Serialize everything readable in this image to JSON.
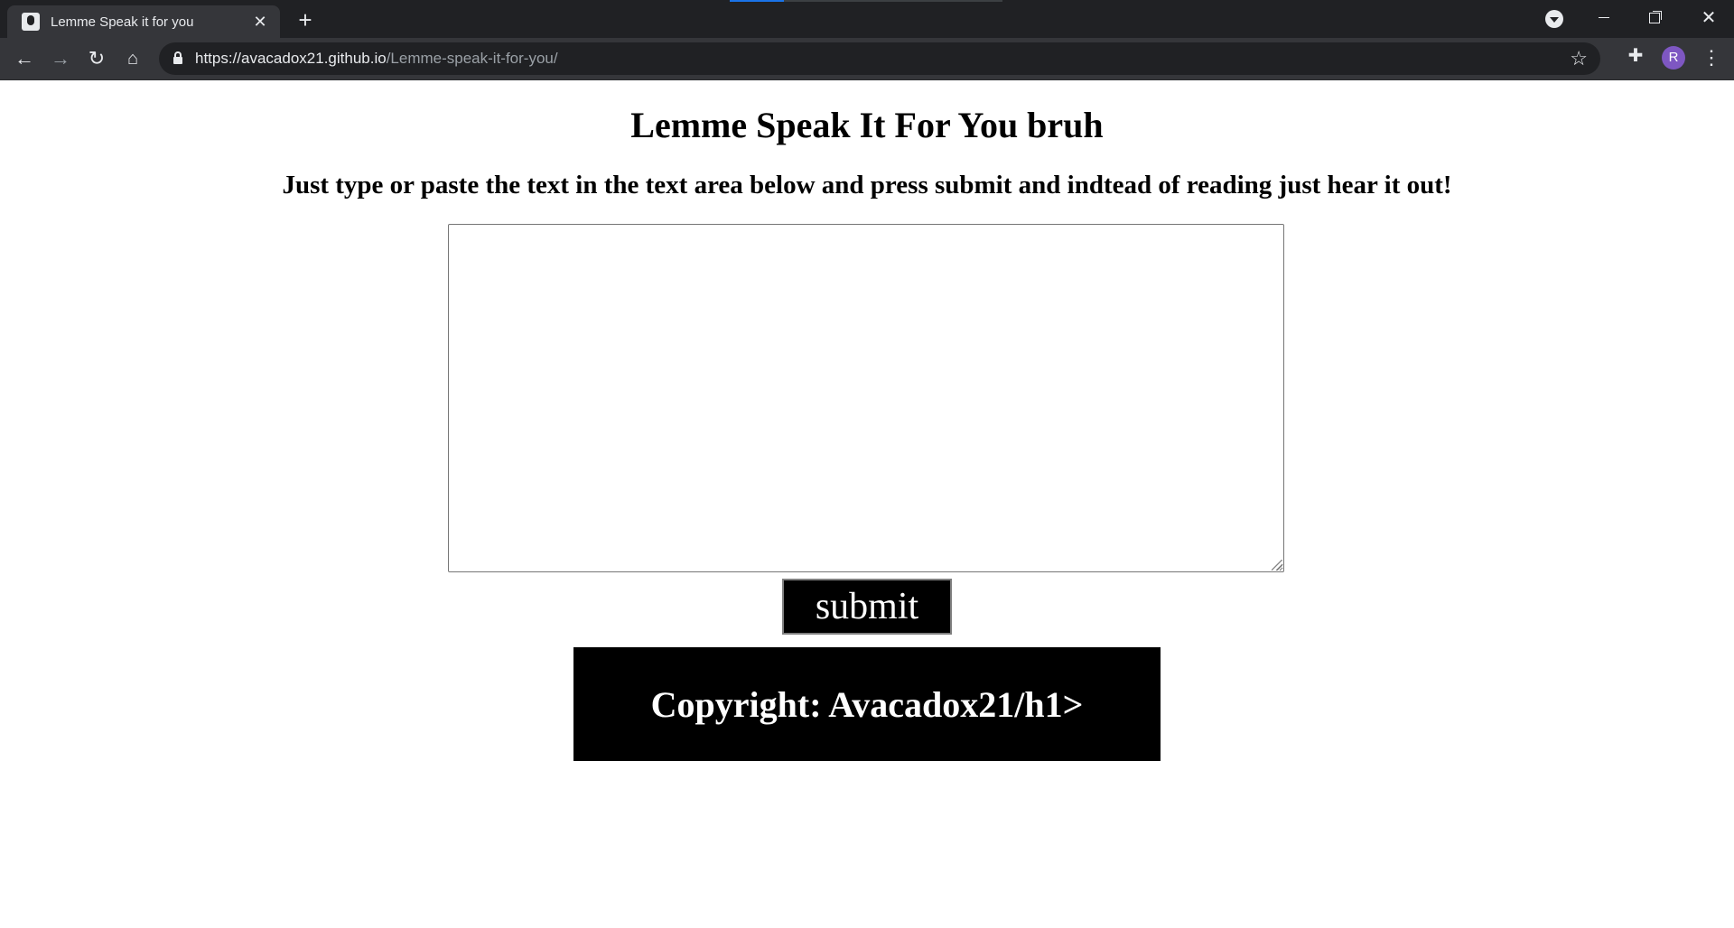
{
  "browser": {
    "tab": {
      "title": "Lemme Speak it for you",
      "close_glyph": "✕"
    },
    "new_tab_glyph": "+",
    "window_controls": {
      "close_glyph": "✕"
    },
    "nav": {
      "back_glyph": "←",
      "forward_glyph": "→",
      "reload_glyph": "↻",
      "home_glyph": "⌂"
    },
    "url": {
      "host": "https://avacadox21.github.io",
      "path": "/Lemme-speak-it-for-you/"
    },
    "bookmark_glyph": "☆",
    "extensions_glyph": "✚",
    "profile_initial": "R",
    "menu_glyph": "⋮",
    "colors": {
      "tabstrip": "#202124",
      "toolbar": "#35363a",
      "avatar": "#7e57c2"
    }
  },
  "page": {
    "title": "Lemme Speak It For You bruh",
    "subtitle": "Just type or paste the text in the text area below and press submit and indtead of reading just hear it out!",
    "textarea": {
      "value": "",
      "placeholder": ""
    },
    "submit_label": "submit",
    "footer_text": "Copyright: Avacadox21/h1>"
  }
}
